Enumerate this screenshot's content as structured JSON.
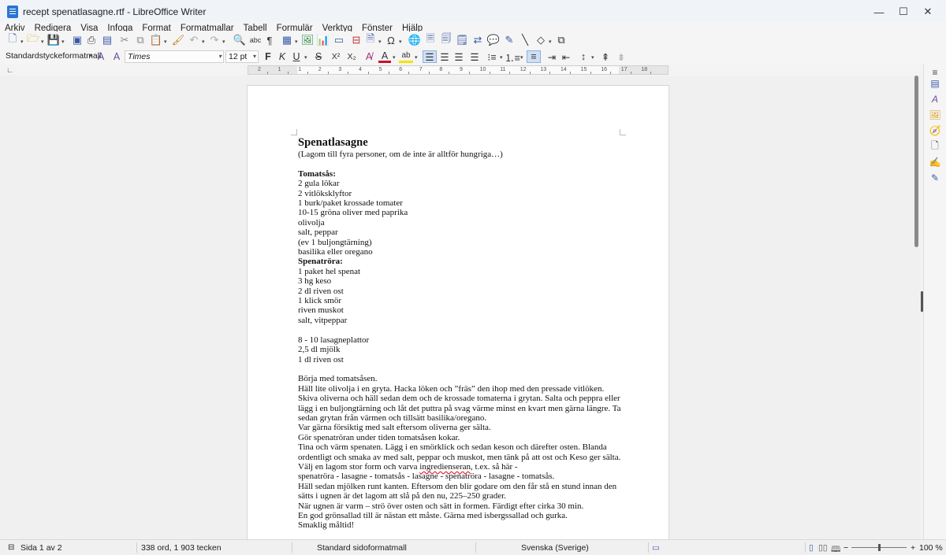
{
  "window": {
    "title": "recept spenatlasagne.rtf - LibreOffice Writer",
    "controls": {
      "minimize": "—",
      "maximize": "☐",
      "close": "✕"
    }
  },
  "menu": [
    "Arkiv",
    "Redigera",
    "Visa",
    "Infoga",
    "Format",
    "Formatmallar",
    "Tabell",
    "Formulär",
    "Verktyg",
    "Fönster",
    "Hjälp"
  ],
  "toolbar2": {
    "paragraph_style": "Standardstyckeformatmall",
    "font_name": "Times",
    "font_size": "12 pt",
    "bold": "F",
    "italic": "K",
    "underline": "U",
    "strike": "S",
    "superscript": "X²",
    "subscript": "X₂",
    "font_color_letter": "A",
    "highlight_letter": "ab"
  },
  "ruler": {
    "ticks": [
      "2",
      "1",
      "1",
      "2",
      "3",
      "4",
      "5",
      "6",
      "7",
      "8",
      "9",
      "10",
      "11",
      "12",
      "13",
      "14",
      "15",
      "16",
      "17",
      "18"
    ]
  },
  "document": {
    "title": "Spenatlasagne",
    "subtitle": "(Lagom till fyra personer, om de inte är alltför hungriga…)",
    "tomatsas_heading": "Tomatsås:",
    "tomatsas_items": [
      "2 gula lökar",
      "2 vitlöksklyftor",
      "1 burk/paket krossade tomater",
      "10-15 gröna oliver med paprika",
      "olivolja",
      "salt, peppar",
      "(ev 1 buljongtärning)",
      "basilika eller oregano"
    ],
    "spenatrora_heading": "Spenatröra:",
    "spenatrora_items": [
      "1 paket hel spenat",
      "3 hg keso",
      "2 dl riven ost",
      "1 klick smör",
      "riven muskot",
      "salt, vitpeppar"
    ],
    "lasagne_items": [
      "8 - 10 lasagneplattor",
      "2,5 dl mjölk",
      "1 dl riven ost"
    ],
    "instructions": [
      "Börja med tomatsåsen.",
      "Häll lite olivolja i en gryta. Hacka löken och ”fräs” den ihop med den pressade vitlöken.",
      "Skiva oliverna och häll sedan dem och de krossade tomaterna i grytan. Salta och peppra eller",
      "lägg i en buljongtärning och låt det puttra på svag värme minst en kvart men gärna längre. Ta",
      "sedan grytan från värmen och tillsätt basilika/oregano.",
      "Var gärna försiktig med salt eftersom oliverna ger sälta.",
      "Gör spenatröran under tiden tomatsåsen kokar.",
      "Tina och värm spenaten. Lägg i en smörklick och sedan keson och därefter osten. Blanda",
      "ordentligt och smaka av med salt, peppar och muskot, men tänk på att ost och Keso ger sälta."
    ],
    "layer_line_pre": "Välj en lagom stor form och varva ",
    "layer_line_misspelled": "ingredienseran",
    "layer_line_post": ", t.ex. så här -",
    "instructions2": [
      "spenatröra - lasagne - tomatsås - lasagne - spenatröra - lasagne - tomatsås.",
      "Häll sedan mjölken runt kanten. Eftersom den blir godare om den får stå en stund innan den",
      "sätts i ugnen är det lagom att slå på den nu, 225–250 grader.",
      "När ugnen är varm – strö över osten och sätt in formen. Färdigt efter cirka 30 min.",
      "En god grönsallad till är nästan ett måste. Gärna med isbergssallad och gurka.",
      "Smaklig måltid!"
    ]
  },
  "statusbar": {
    "page": "Sida 1 av 2",
    "words": "338 ord, 1 903 tecken",
    "page_style": "Standard sidoformatmall",
    "language": "Svenska (Sverige)",
    "zoom": "100 %",
    "zoom_minus": "−",
    "zoom_plus": "+"
  }
}
